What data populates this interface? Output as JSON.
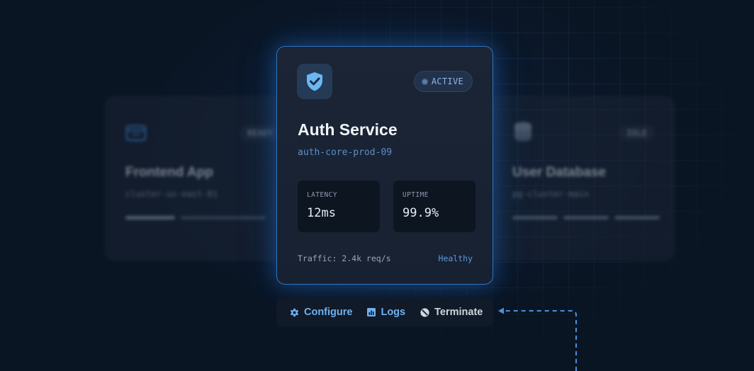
{
  "background_cards": {
    "left": {
      "title": "Frontend App",
      "subtitle": "cluster-us-east-01",
      "status": "READY",
      "icon": "browser-window-icon"
    },
    "right": {
      "title": "User Database",
      "subtitle": "pg-cluster-main",
      "status": "IDLE",
      "icon": "database-icon"
    }
  },
  "service_card": {
    "icon": "shield-check-icon",
    "status": "ACTIVE",
    "title": "Auth Service",
    "subtitle": "auth-core-prod-09",
    "metrics": {
      "latency": {
        "label": "LATENCY",
        "value": "12ms"
      },
      "uptime": {
        "label": "UPTIME",
        "value": "99.9%"
      }
    },
    "traffic": "Traffic: 2.4k req/s",
    "health": "Healthy"
  },
  "actions": {
    "configure": {
      "label": "Configure",
      "icon": "gear-icon"
    },
    "logs": {
      "label": "Logs",
      "icon": "bar-chart-icon"
    },
    "terminate": {
      "label": "Terminate",
      "icon": "prohibited-icon"
    }
  },
  "colors": {
    "accent": "#2f74c0",
    "accent_text": "#6fb0f0",
    "background": "#0a1524",
    "card": "#1b2535"
  }
}
